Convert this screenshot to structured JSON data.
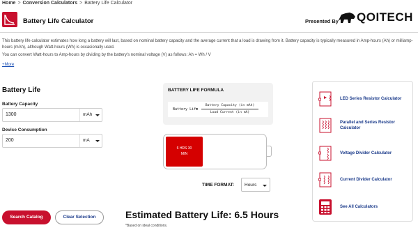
{
  "breadcrumb": [
    "Home",
    "Conversion Calculators",
    "Battery Life Calculator"
  ],
  "header": {
    "title": "Battery Life Calculator",
    "presented_by": "Presented By",
    "brand": "QOITECH"
  },
  "description": {
    "paragraph1": "This battery life calculator estimates how long a battery will last, based on nominal battery capacity and the average current that a load is drawing from it. Battery capacity is typically measured in Amp-hours (Ah) or milliamp-hours (mAh), although Watt-hours (Wh) is occasionally used.",
    "paragraph2": "You can convert Watt-hours to Amp-hours by dividing by the battery's nominal voltage (V) as follows: Ah = Wh / V",
    "more_link": "+More"
  },
  "form": {
    "section_title": "Battery Life",
    "capacity_label": "Battery Capacity",
    "capacity_value": "1300",
    "capacity_unit": "mAh",
    "consumption_label": "Device Consumption",
    "consumption_value": "200",
    "consumption_unit": "mA"
  },
  "formula": {
    "title": "BATTERY LIFE FORMULA",
    "lhs": "Battery Life",
    "eq": "=",
    "numerator": "Battery Capacity (in mAh)",
    "denominator": "Load Current (in mA)"
  },
  "battery": {
    "fill_text_line1": "6 HRS 30",
    "fill_text_line2": "MIN",
    "fill_color": "#d50000"
  },
  "time_format": {
    "label": "TIME FORMAT:",
    "value": "Hours"
  },
  "buttons": {
    "search": "Search Catalog",
    "clear": "Clear Selection"
  },
  "result": {
    "text": "Estimated Battery Life: 6.5 Hours",
    "note": "*Based on ideal conditions."
  },
  "related": [
    {
      "label": "LED Series Resistor Calculator",
      "icon": "led-resistor-circuit-icon"
    },
    {
      "label": "Parallel and Series Resistor Calculator",
      "icon": "parallel-series-resistor-icon"
    },
    {
      "label": "Voltage Divider Calculator",
      "icon": "voltage-divider-icon"
    },
    {
      "label": "Current Divider Calculator",
      "icon": "current-divider-icon"
    },
    {
      "label": "See All Calculators",
      "icon": "calculator-icon"
    }
  ],
  "colors": {
    "accent": "#c8102e",
    "link": "#1a3a8a"
  }
}
